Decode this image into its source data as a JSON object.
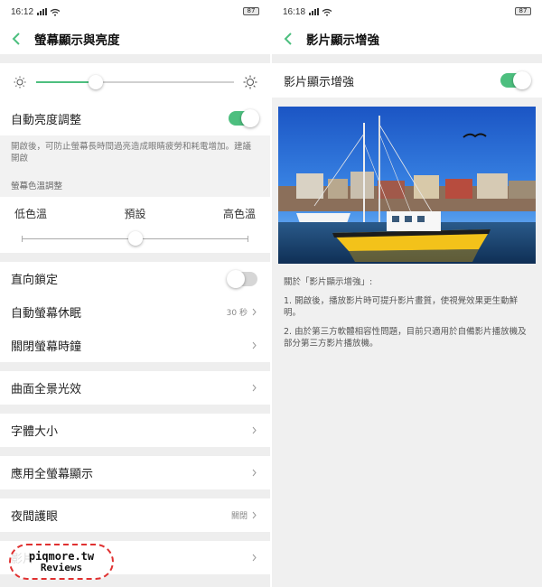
{
  "left": {
    "status": {
      "time": "16:12",
      "battery": "87"
    },
    "header": {
      "title": "螢幕顯示與亮度"
    },
    "brightness": {
      "level_percent": 30
    },
    "auto_brightness": {
      "label": "自動亮度調整",
      "enabled": true
    },
    "auto_brightness_hint": "開啟後，可防止螢幕長時間過亮造成眼睛疲勞和耗電增加。建議開啟",
    "color_temp": {
      "section_label": "螢幕色溫調整",
      "low": "低色溫",
      "default": "預設",
      "high": "高色溫",
      "level_percent": 50
    },
    "rows": {
      "rotation_lock": {
        "label": "直向鎖定",
        "enabled": false
      },
      "auto_sleep": {
        "label": "自動螢幕休眠",
        "value": "30 秒"
      },
      "lock_clock": {
        "label": "關閉螢幕時鐘"
      },
      "curved_light": {
        "label": "曲面全景光效"
      },
      "font_size": {
        "label": "字體大小"
      },
      "full_screen": {
        "label": "應用全螢幕顯示"
      },
      "night_mode": {
        "label": "夜間護眼",
        "value": "關閉"
      },
      "video_enhance": {
        "label": "影片"
      }
    },
    "watermark": {
      "line1": "piqmore.tw",
      "line2": "Reviews"
    }
  },
  "right": {
    "status": {
      "time": "16:18",
      "battery": "87"
    },
    "header": {
      "title": "影片顯示增強"
    },
    "toggle_row": {
      "label": "影片顯示增強",
      "enabled": true
    },
    "about": {
      "heading": "關於「影片顯示增強」:",
      "item1": "1. 開啟後，播放影片時可提升影片畫質，使視覺效果更生動鮮明。",
      "item2": "2. 由於第三方軟體相容性問題，目前只適用於自備影片播放機及部分第三方影片播放機。"
    }
  },
  "colors": {
    "accent": "#4dbf7f",
    "toggle_off": "#d6d6d6"
  }
}
